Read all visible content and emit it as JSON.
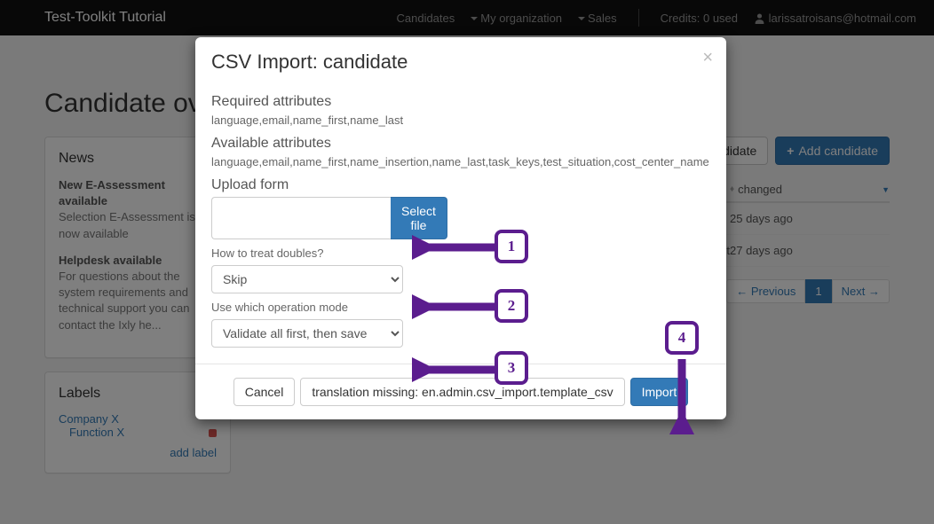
{
  "navbar": {
    "brand": "Test-Toolkit Tutorial",
    "links": {
      "candidates": "Candidates",
      "my_org": "My organization",
      "sales": "Sales",
      "credits": "Credits: 0 used",
      "user": "larissatroisans@hotmail.com"
    }
  },
  "page": {
    "title": "Candidate overview"
  },
  "toolbar": {
    "csv_import": "CSV Import: candidate",
    "add_candidate": "Add candidate"
  },
  "news_panel": {
    "title": "News",
    "items": [
      {
        "title": "New E-Assessment available",
        "body": "Selection E-Assessment is now available"
      },
      {
        "title": "Helpdesk available",
        "body": "For questions about the system requirements and technical support you can contact the Ixly he..."
      }
    ]
  },
  "labels_panel": {
    "title": "Labels",
    "lvl1": "Company X",
    "lvl2": "Function X",
    "add_label": "add label"
  },
  "table": {
    "col_changed": "changed",
    "rows": [
      {
        "status": "",
        "changed": "25 days ago"
      },
      {
        "status": "ted yet",
        "changed": "27 days ago"
      }
    ]
  },
  "pager": {
    "prev": "← Previous",
    "page": "1",
    "next": "Next →"
  },
  "modal": {
    "title": "CSV Import: candidate",
    "required_label": "Required attributes",
    "required_vals": "language,email,name_first,name_last",
    "available_label": "Available attributes",
    "available_vals": "language,email,name_first,name_insertion,name_last,task_keys,test_situation,cost_center_name",
    "upload_label": "Upload form",
    "select_file": "Select file",
    "doubles_label": "How to treat doubles?",
    "doubles_value": "Skip",
    "mode_label": "Use which operation mode",
    "mode_value": "Validate all first, then save",
    "cancel": "Cancel",
    "template": "translation missing: en.admin.csv_import.template_csv",
    "import": "Import"
  },
  "annotations": {
    "a1": "1",
    "a2": "2",
    "a3": "3",
    "a4": "4"
  }
}
